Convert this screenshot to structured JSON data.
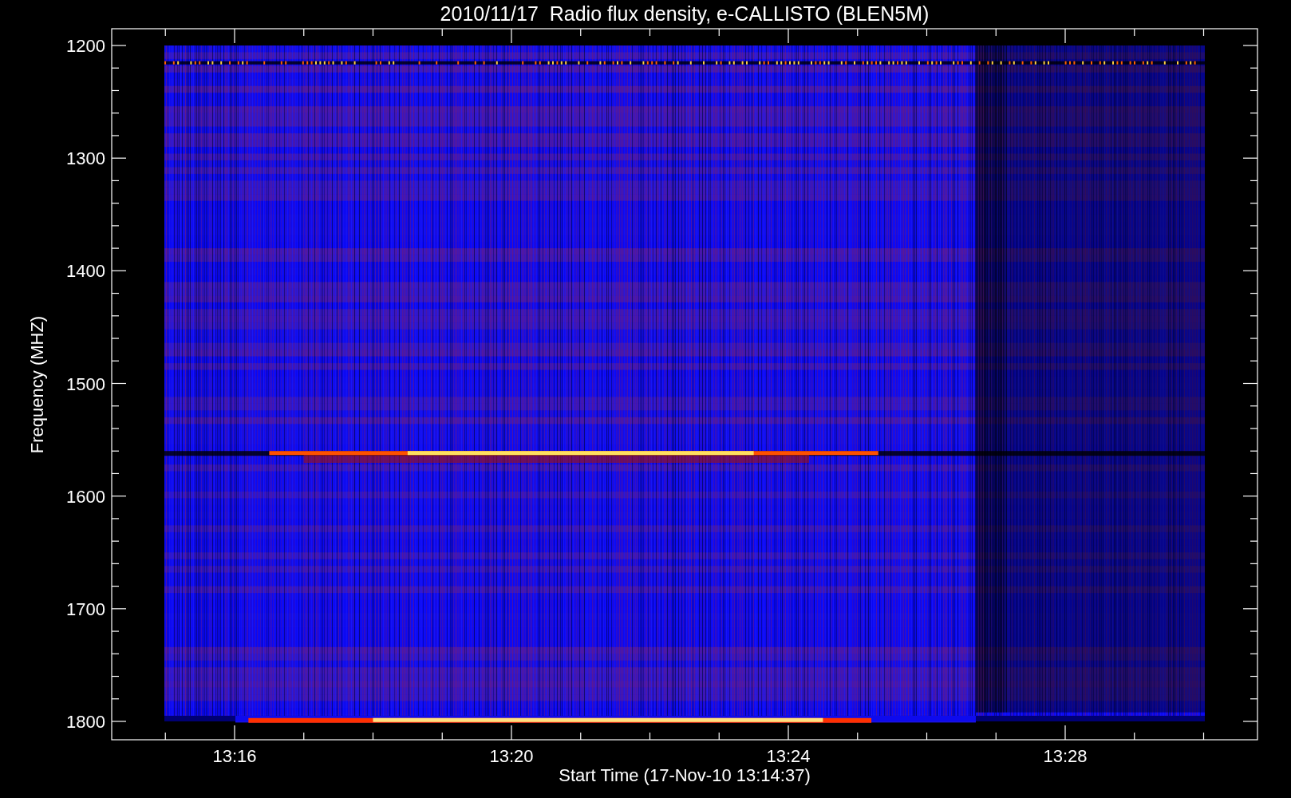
{
  "title": "2010/11/17  Radio flux density, e-CALLISTO (BLEN5M)",
  "y_axis": {
    "label": "Frequency (MHZ)",
    "ticks": [
      "1200",
      "1300",
      "1400",
      "1500",
      "1600",
      "1700",
      "1800"
    ]
  },
  "x_axis": {
    "label": "Start Time (17-Nov-10 13:14:37)",
    "ticks": [
      "13:16",
      "13:20",
      "13:24",
      "13:28"
    ]
  }
}
